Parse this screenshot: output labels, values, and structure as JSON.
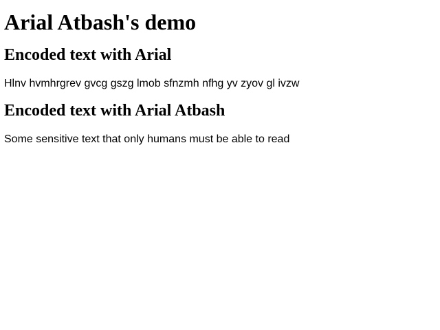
{
  "page": {
    "title": "Arial Atbash's demo",
    "sections": [
      {
        "heading": "Encoded text with Arial",
        "text": "Hlnv hvmhrgrev gvcg gszg lmob sfnzmh nfhg yv zyov gl ivzw"
      },
      {
        "heading": "Encoded text with Arial Atbash",
        "text": "Some sensitive text that only humans must be able to read"
      }
    ]
  }
}
